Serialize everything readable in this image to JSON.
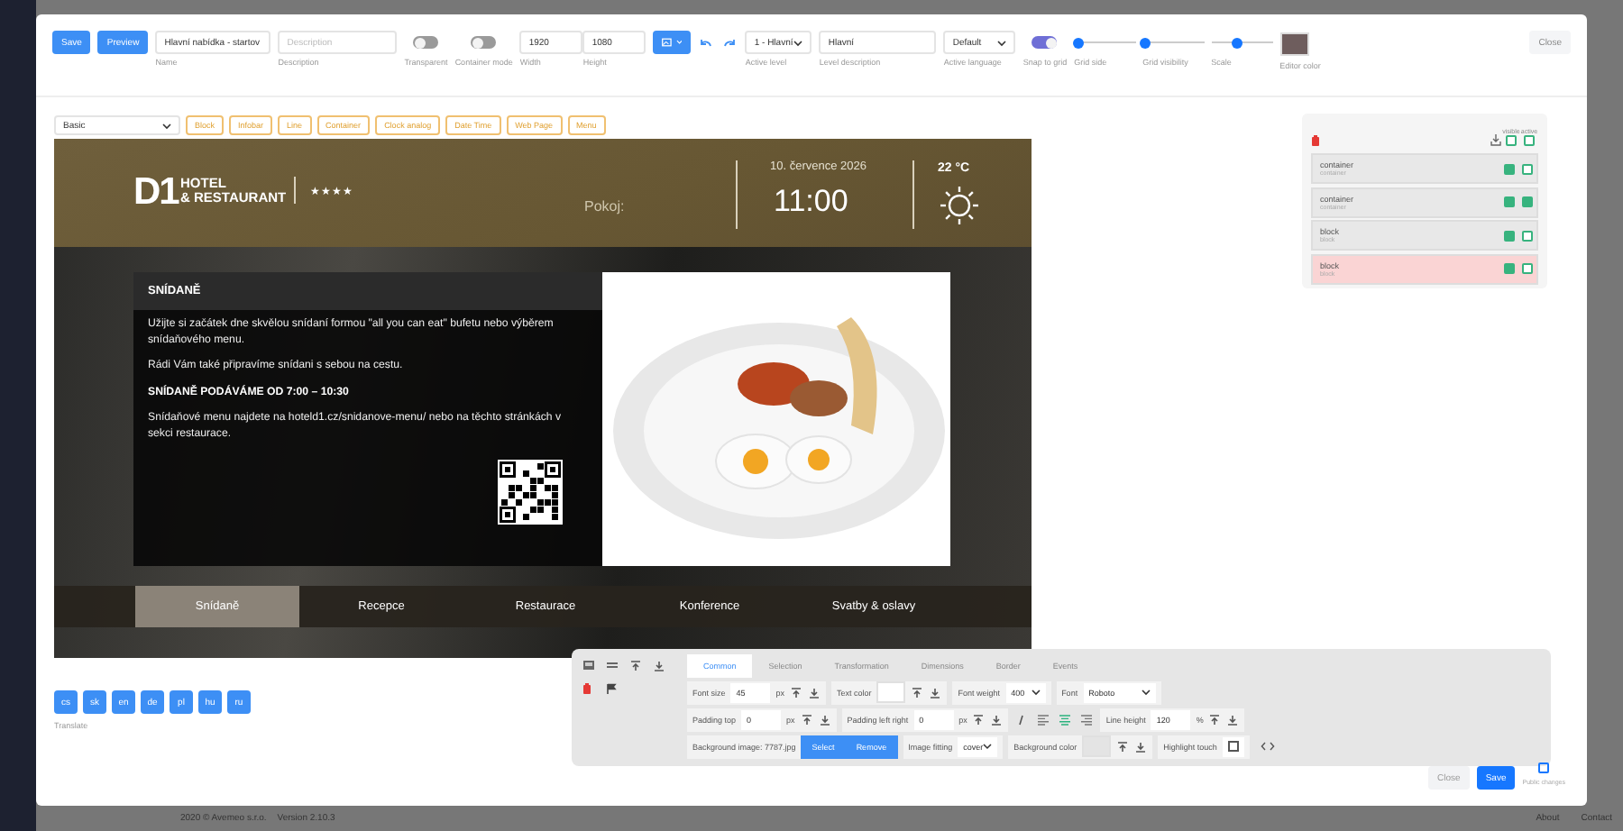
{
  "page": {
    "copyright": "2020 © Avemeo s.r.o.",
    "version": "Version 2.10.3",
    "links": [
      "About",
      "Contact"
    ]
  },
  "toolbar": {
    "buttons": [
      "Save",
      "Preview"
    ],
    "name": {
      "label": "Name",
      "value": "Hlavní nabídka - startov"
    },
    "description": {
      "label": "Description",
      "placeholder": "Description"
    },
    "toggles": [
      {
        "label": "Transparent",
        "on": false
      },
      {
        "label": "Container mode",
        "on": false
      }
    ],
    "width": {
      "label": "Width",
      "value": "1920"
    },
    "height": {
      "label": "Height",
      "value": "1080"
    },
    "active_level": {
      "label": "Active level",
      "value": "1 - Hlavní"
    },
    "level_description": {
      "label": "Level description",
      "value": "Hlavní"
    },
    "active_language": {
      "label": "Active language",
      "value": "Default"
    },
    "snap": {
      "label": "Snap to grid",
      "on": true
    },
    "sliders": [
      {
        "label": "Grid side",
        "level": 0.08
      },
      {
        "label": "Grid visibility",
        "level": 0.05
      },
      {
        "label": "Scale",
        "level": 0.42
      }
    ],
    "editor_color": {
      "label": "Editor color"
    },
    "close": "Close"
  },
  "templates": {
    "preset": "Basic",
    "buttons": [
      "Block",
      "Infobar",
      "Line",
      "Container",
      "Clock analog",
      "Date Time",
      "Web Page",
      "Menu"
    ]
  },
  "stage": {
    "logo_mark": "D1",
    "logo_lines": [
      "HOTEL",
      "& RESTAURANT"
    ],
    "stars": "★★★★",
    "room_label": "Pokoj:",
    "date": "10. července 2026",
    "time": "11:00",
    "temperature": "22 °C",
    "section_title": "SNÍDANĚ",
    "paragraphs": [
      {
        "kind": "normal",
        "text": "Užijte si začátek dne skvělou snídaní formou \"all you can eat\" bufetu nebo výběrem snídaňového menu."
      },
      {
        "kind": "normal",
        "text": "Rádi Vám také připravíme snídani s sebou na cestu."
      },
      {
        "kind": "emphasis",
        "text": "SNÍDANĚ PODÁVÁME OD 7:00 – 10:30"
      },
      {
        "kind": "normal",
        "text": "Snídaňové menu najdete na hoteld1.cz/snidanove-menu/ nebo na těchto stránkách v sekci restaurace."
      }
    ],
    "menu": [
      {
        "label": "Snídaně",
        "selected": true
      },
      {
        "label": "Recepce",
        "selected": false
      },
      {
        "label": "Restaurace",
        "selected": false
      },
      {
        "label": "Konference",
        "selected": false
      },
      {
        "label": "Svatby & oslavy",
        "selected": false
      }
    ]
  },
  "languages": {
    "buttons": [
      "cs",
      "sk",
      "en",
      "de",
      "pl",
      "hu",
      "ru"
    ],
    "label": "Translate"
  },
  "layers": {
    "headers": [
      {
        "label": "visible",
        "checked": false
      },
      {
        "label": "active",
        "checked": false
      }
    ],
    "items": [
      {
        "name": "container",
        "type": "container",
        "visible": true,
        "active": false,
        "selected": false
      },
      {
        "name": "container",
        "type": "container",
        "visible": true,
        "active": true,
        "selected": false
      },
      {
        "name": "block",
        "type": "block",
        "visible": true,
        "active": false,
        "selected": false
      },
      {
        "name": "block",
        "type": "block",
        "visible": true,
        "active": false,
        "selected": true
      }
    ]
  },
  "properties": {
    "tabs": [
      {
        "label": "Common",
        "selected": true
      },
      {
        "label": "Selection",
        "selected": false
      },
      {
        "label": "Transformation",
        "selected": false
      },
      {
        "label": "Dimensions",
        "selected": false
      },
      {
        "label": "Border",
        "selected": false
      },
      {
        "label": "Events",
        "selected": false
      }
    ],
    "rows": [
      [
        {
          "kind": "number",
          "label": "Font size",
          "value": "45",
          "unit": "px"
        },
        {
          "kind": "color",
          "label": "Text color",
          "color": "#ffffff"
        },
        {
          "kind": "select",
          "label": "Font weight",
          "value": "400"
        },
        {
          "kind": "select",
          "label": "Font",
          "value": "Roboto"
        }
      ],
      [
        {
          "kind": "number",
          "label": "Padding top",
          "value": "0",
          "unit": "px"
        },
        {
          "kind": "number",
          "label": "Padding left right",
          "value": "0",
          "unit": "px"
        },
        {
          "kind": "format",
          "buttons": [
            {
              "kind": "italic",
              "selected": false
            },
            {
              "kind": "align-left",
              "selected": false
            },
            {
              "kind": "align-center",
              "selected": true
            },
            {
              "kind": "align-right",
              "selected": false
            }
          ]
        },
        {
          "kind": "number",
          "label": "Line height",
          "value": "120",
          "unit": "%"
        }
      ],
      [
        {
          "kind": "image",
          "label": "Background image: 7787.jpg",
          "buttons": [
            "Select",
            "Remove"
          ]
        },
        {
          "kind": "select",
          "label": "Image fitting",
          "value": "cover"
        },
        {
          "kind": "color",
          "label": "Background color",
          "color": "#e4e4e4"
        },
        {
          "kind": "checkbox",
          "label": "Highlight touch",
          "checked": false
        },
        {
          "kind": "code"
        }
      ]
    ]
  },
  "footer": {
    "close": "Close",
    "save": "Save",
    "public_changes": {
      "label": "Public changes",
      "checked": false
    }
  }
}
